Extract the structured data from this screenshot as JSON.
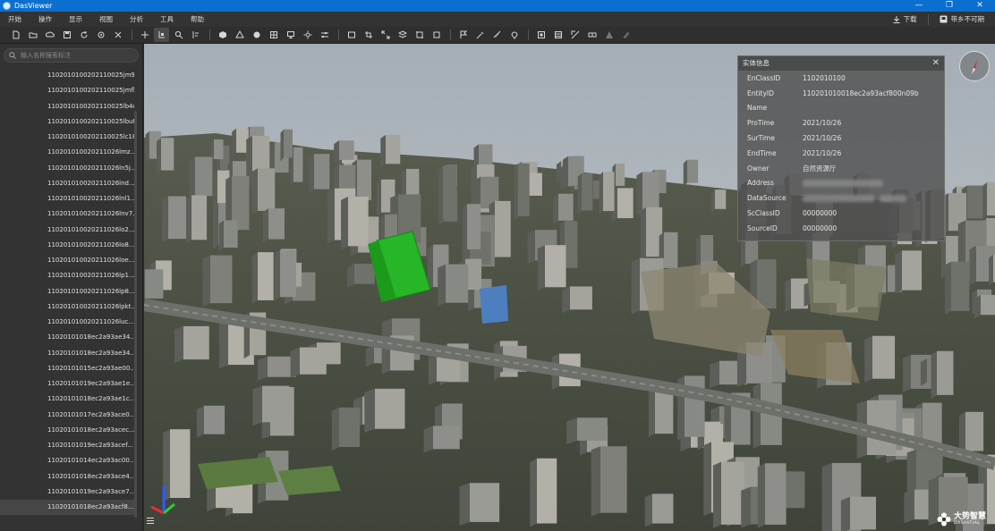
{
  "window": {
    "title": "DasViewer",
    "controls": {
      "minimize": "—",
      "restore": "❐",
      "close": "✕"
    }
  },
  "menu": {
    "items": [
      "开始",
      "操作",
      "显示",
      "视图",
      "分析",
      "工具",
      "帮助"
    ],
    "download_label": "下载",
    "weather_label": "带乡不可期"
  },
  "toolbar": {
    "groups": [
      [
        "new-file-icon",
        "open-folder-icon",
        "cloud-open-icon",
        "save-icon",
        "refresh-icon",
        "settings-icon",
        "close-icon"
      ],
      [
        "move-icon",
        "select-icon",
        "search-icon",
        "align-icon"
      ],
      [
        "cube-icon",
        "mesh-icon",
        "sphere-icon",
        "grid-icon",
        "monitor-icon",
        "sun-icon",
        "sliders-icon"
      ],
      [
        "frame-icon",
        "crop-icon",
        "expand-icon",
        "layers-icon",
        "clip-icon",
        "box-icon"
      ],
      [
        "flag-icon",
        "tool-icon",
        "measure-icon",
        "pin-icon"
      ],
      [
        "stop-icon",
        "texture-icon",
        "transform-icon",
        "link-icon",
        "warning-icon",
        "brush-icon"
      ]
    ]
  },
  "sidebar": {
    "search_placeholder": "输入名称搜索标注",
    "items": [
      "1102010100202110025jm9...",
      "1102010100202110025jmfl...",
      "1102010100202110025lb4d...",
      "1102010100202110025lbut...",
      "1102010100202110025lc18...",
      "110201010020211026lmz...",
      "110201010020211026ln5j...",
      "110201010020211026lnd...",
      "110201010020211026lnl1...",
      "110201010020211026lnv7...",
      "110201010020211026lo2...",
      "110201010020211026lo8...",
      "110201010020211026loe...",
      "110201010020211026lp1...",
      "110201010020211026lp8...",
      "110201010020211026lpkt...",
      "110201010020211026luc...",
      "11020101018ec2a93ae34...",
      "11020101018ec2a93ae34...",
      "11020101015ec2a93ae00...",
      "11020101019ec2a93ae1e...",
      "11020101018ec2a93ae1c...",
      "11020101017ec2a93ace0...",
      "11020101018ec2a93acec...",
      "11020101019ec2a93acef...",
      "11020101014ec2a93ac00...",
      "11020101018ec2a93ace4...",
      "11020101019ec2a93ace7...",
      "11020101018ec2a93acf8..."
    ],
    "selected_index": 28
  },
  "info_panel": {
    "title": "实体信息",
    "close": "✕",
    "rows": [
      {
        "key": "EnClassID",
        "value": "1102010100"
      },
      {
        "key": "EntityID",
        "value": "110201010018ec2a93acf800n09b"
      },
      {
        "key": "Name",
        "value": ""
      },
      {
        "key": "ProTime",
        "value": "2021/10/26"
      },
      {
        "key": "SurTime",
        "value": "2021/10/26"
      },
      {
        "key": "EndTime",
        "value": "2021/10/26"
      },
      {
        "key": "Owner",
        "value": "自然资源厅"
      },
      {
        "key": "Address",
        "value": ""
      },
      {
        "key": "DataSource",
        "value": ""
      },
      {
        "key": "ScClassID",
        "value": "00000000"
      },
      {
        "key": "SourceID",
        "value": "00000000"
      }
    ]
  },
  "brand": {
    "name_cn": "大势智慧",
    "name_en": "DASPATIAL"
  },
  "colors": {
    "titlebar": "#0b6fd0",
    "highlight_building": "#23c423",
    "sky": "#a8b1b8"
  }
}
